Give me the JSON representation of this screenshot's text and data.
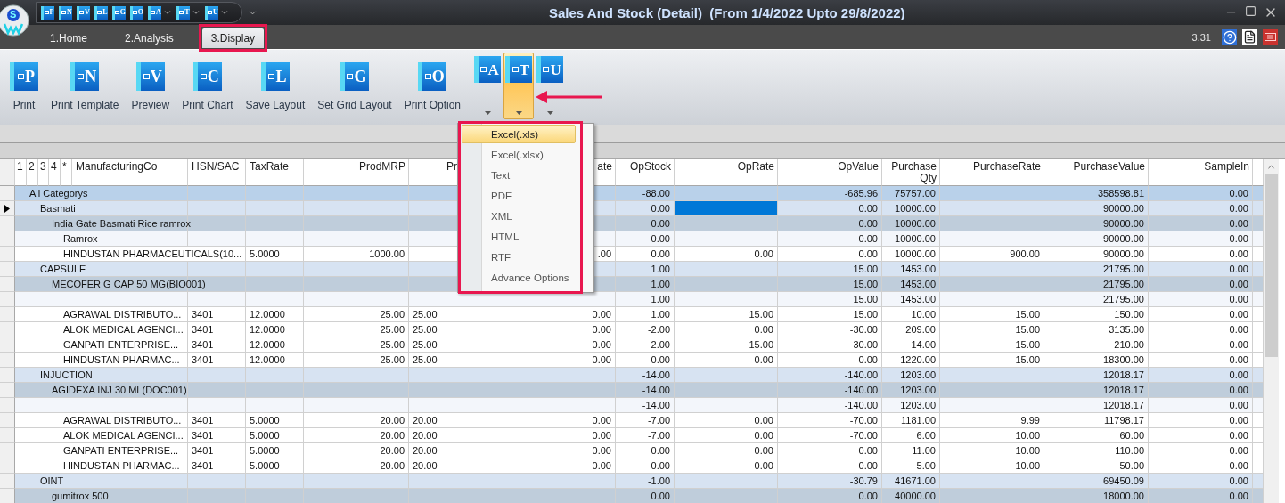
{
  "logo": {
    "letter": "S"
  },
  "quick_access": [
    {
      "letter": "P",
      "dropdown": false
    },
    {
      "letter": "N",
      "dropdown": false
    },
    {
      "letter": "V",
      "dropdown": false
    },
    {
      "letter": "L",
      "dropdown": false
    },
    {
      "letter": "G",
      "dropdown": false
    },
    {
      "letter": "O",
      "dropdown": false
    },
    {
      "letter": "A",
      "dropdown": true
    },
    {
      "letter": "T",
      "dropdown": true
    },
    {
      "letter": "U",
      "dropdown": true
    }
  ],
  "window": {
    "title": "Sales And Stock (Detail)  (From 1/4/2022 Upto 29/8/2022)"
  },
  "tabs": [
    {
      "label": "1.Home",
      "selected": false,
      "highlighted": false
    },
    {
      "label": "2.Analysis",
      "selected": false,
      "highlighted": false
    },
    {
      "label": "3.Display",
      "selected": true,
      "highlighted": true
    }
  ],
  "version": "3.31",
  "ribbon": [
    {
      "kind": "large",
      "letter": "P",
      "label": "Print",
      "pressed": false
    },
    {
      "kind": "large",
      "letter": "N",
      "label": "Print Template",
      "pressed": false
    },
    {
      "kind": "large",
      "letter": "V",
      "label": "Preview",
      "pressed": false
    },
    {
      "kind": "large",
      "letter": "C",
      "label": "Print Chart",
      "pressed": false
    },
    {
      "kind": "large",
      "letter": "L",
      "label": "Save Layout",
      "pressed": false
    },
    {
      "kind": "large",
      "letter": "G",
      "label": "Set Grid Layout",
      "pressed": false
    },
    {
      "kind": "large",
      "letter": "O",
      "label": "Print Option",
      "pressed": false
    },
    {
      "kind": "menu",
      "letter": "A",
      "pressed": false
    },
    {
      "kind": "menu",
      "letter": "T",
      "pressed": true
    },
    {
      "kind": "menu",
      "letter": "U",
      "pressed": false
    }
  ],
  "annotation_arrow": true,
  "export_menu": {
    "highlighted": true,
    "items": [
      {
        "label": "Excel(.xls)",
        "selected": true
      },
      {
        "label": "Excel(.xlsx)",
        "selected": false
      },
      {
        "label": "Text",
        "selected": false
      },
      {
        "label": "PDF",
        "selected": false
      },
      {
        "label": "XML",
        "selected": false
      },
      {
        "label": "HTML",
        "selected": false
      },
      {
        "label": "RTF",
        "selected": false
      },
      {
        "label": "Advance Options",
        "selected": false
      }
    ]
  },
  "table": {
    "levels": [
      "1",
      "2",
      "3",
      "4",
      "*"
    ],
    "columns": [
      {
        "label": "ManufacturingCo",
        "kind": "text"
      },
      {
        "label": "HSN/SAC",
        "kind": "text"
      },
      {
        "label": "TaxRate",
        "kind": "text"
      },
      {
        "label": "ProdMRP",
        "kind": "number"
      },
      {
        "label": "Pr",
        "kind": "cut"
      },
      {
        "label": "ate",
        "kind": "number"
      },
      {
        "label": "OpStock",
        "kind": "number"
      },
      {
        "label": "OpRate",
        "kind": "number"
      },
      {
        "label": "OpValue",
        "kind": "number"
      },
      {
        "label": "PurchaseQty",
        "kind": "number"
      },
      {
        "label": "PurchaseRate",
        "kind": "number"
      },
      {
        "label": "PurchaseValue",
        "kind": "number"
      },
      {
        "label": "SampleIn",
        "kind": "number"
      }
    ],
    "rows": [
      {
        "kind": "group0",
        "current": false,
        "cells": [
          "All Categorys",
          null,
          null,
          null,
          null,
          null,
          "-88.00",
          null,
          "-685.96",
          "75757.00",
          null,
          "358598.81",
          "0.00"
        ]
      },
      {
        "kind": "group1",
        "current": true,
        "cells": [
          "Basmati",
          null,
          null,
          null,
          null,
          null,
          "0.00",
          {
            "selected": true
          },
          "0.00",
          "10000.00",
          null,
          "90000.00",
          "0.00"
        ]
      },
      {
        "kind": "group2",
        "current": false,
        "cells": [
          "India Gate Basmati Rice ramrox",
          null,
          null,
          null,
          null,
          null,
          "0.00",
          null,
          "0.00",
          "10000.00",
          null,
          "90000.00",
          "0.00"
        ]
      },
      {
        "kind": "group3",
        "current": false,
        "cells": [
          "Ramrox",
          null,
          null,
          null,
          null,
          null,
          "0.00",
          null,
          "0.00",
          "10000.00",
          null,
          "90000.00",
          "0.00"
        ]
      },
      {
        "kind": "detail",
        "current": false,
        "cells": [
          "HINDUSTAN PHARMACEUTICALS(10...",
          null,
          "5.0000",
          "1000.00",
          null,
          ".00",
          "0.00",
          "0.00",
          "0.00",
          "10000.00",
          "900.00",
          "90000.00",
          "0.00"
        ]
      },
      {
        "kind": "group1",
        "current": false,
        "cells": [
          "CAPSULE",
          null,
          null,
          null,
          null,
          null,
          "1.00",
          null,
          "15.00",
          "1453.00",
          null,
          "21795.00",
          "0.00"
        ]
      },
      {
        "kind": "group2",
        "current": false,
        "cells": [
          "MECOFER G CAP 50 MG(BIO001)",
          null,
          null,
          null,
          null,
          null,
          "1.00",
          null,
          "15.00",
          "1453.00",
          null,
          "21795.00",
          "0.00"
        ]
      },
      {
        "kind": "group3",
        "current": false,
        "cells": [
          null,
          null,
          null,
          null,
          null,
          null,
          "1.00",
          null,
          "15.00",
          "1453.00",
          null,
          "21795.00",
          "0.00"
        ]
      },
      {
        "kind": "detail",
        "current": false,
        "cells": [
          "AGRAWAL DISTRIBUTO...",
          "3401",
          "12.0000",
          "25.00",
          "25.00",
          "0.00",
          "1.00",
          "15.00",
          "15.00",
          "10.00",
          "15.00",
          "150.00",
          "0.00"
        ]
      },
      {
        "kind": "detail",
        "current": false,
        "cells": [
          "ALOK MEDICAL AGENCI...",
          "3401",
          "12.0000",
          "25.00",
          "25.00",
          "0.00",
          "-2.00",
          "0.00",
          "-30.00",
          "209.00",
          "15.00",
          "3135.00",
          "0.00"
        ]
      },
      {
        "kind": "detail",
        "current": false,
        "cells": [
          "GANPATI ENTERPRISE...",
          "3401",
          "12.0000",
          "25.00",
          "25.00",
          "0.00",
          "2.00",
          "15.00",
          "30.00",
          "14.00",
          "15.00",
          "210.00",
          "0.00"
        ]
      },
      {
        "kind": "detail",
        "current": false,
        "cells": [
          "HINDUSTAN PHARMAC...",
          "3401",
          "12.0000",
          "25.00",
          "25.00",
          "0.00",
          "0.00",
          "0.00",
          "0.00",
          "1220.00",
          "15.00",
          "18300.00",
          "0.00"
        ]
      },
      {
        "kind": "group1",
        "current": false,
        "cells": [
          "INJUCTION",
          null,
          null,
          null,
          null,
          null,
          "-14.00",
          null,
          "-140.00",
          "1203.00",
          null,
          "12018.17",
          "0.00"
        ]
      },
      {
        "kind": "group2",
        "current": false,
        "cells": [
          "AGIDEXA INJ 30 ML(DOC001)",
          null,
          null,
          null,
          null,
          null,
          "-14.00",
          null,
          "-140.00",
          "1203.00",
          null,
          "12018.17",
          "0.00"
        ]
      },
      {
        "kind": "group3",
        "current": false,
        "cells": [
          null,
          null,
          null,
          null,
          null,
          null,
          "-14.00",
          null,
          "-140.00",
          "1203.00",
          null,
          "12018.17",
          "0.00"
        ]
      },
      {
        "kind": "detail",
        "current": false,
        "cells": [
          "AGRAWAL DISTRIBUTO...",
          "3401",
          "5.0000",
          "20.00",
          "20.00",
          "0.00",
          "-7.00",
          "0.00",
          "-70.00",
          "1181.00",
          "9.99",
          "11798.17",
          "0.00"
        ]
      },
      {
        "kind": "detail",
        "current": false,
        "cells": [
          "ALOK MEDICAL AGENCI...",
          "3401",
          "5.0000",
          "20.00",
          "20.00",
          "0.00",
          "-7.00",
          "0.00",
          "-70.00",
          "6.00",
          "10.00",
          "60.00",
          "0.00"
        ]
      },
      {
        "kind": "detail",
        "current": false,
        "cells": [
          "GANPATI ENTERPRISE...",
          "3401",
          "5.0000",
          "20.00",
          "20.00",
          "0.00",
          "0.00",
          "0.00",
          "0.00",
          "11.00",
          "10.00",
          "110.00",
          "0.00"
        ]
      },
      {
        "kind": "detail",
        "current": false,
        "cells": [
          "HINDUSTAN PHARMAC...",
          "3401",
          "5.0000",
          "20.00",
          "20.00",
          "0.00",
          "0.00",
          "0.00",
          "0.00",
          "5.00",
          "10.00",
          "50.00",
          "0.00"
        ]
      },
      {
        "kind": "group1",
        "current": false,
        "cells": [
          "OINT",
          null,
          null,
          null,
          null,
          null,
          "-1.00",
          null,
          "-30.79",
          "41671.00",
          null,
          "69450.09",
          "0.00"
        ]
      },
      {
        "kind": "group2",
        "current": false,
        "cells": [
          "gumitrox 500",
          null,
          null,
          null,
          null,
          null,
          "0.00",
          null,
          "0.00",
          "40000.00",
          null,
          "18000.00",
          "0.00"
        ]
      }
    ]
  }
}
